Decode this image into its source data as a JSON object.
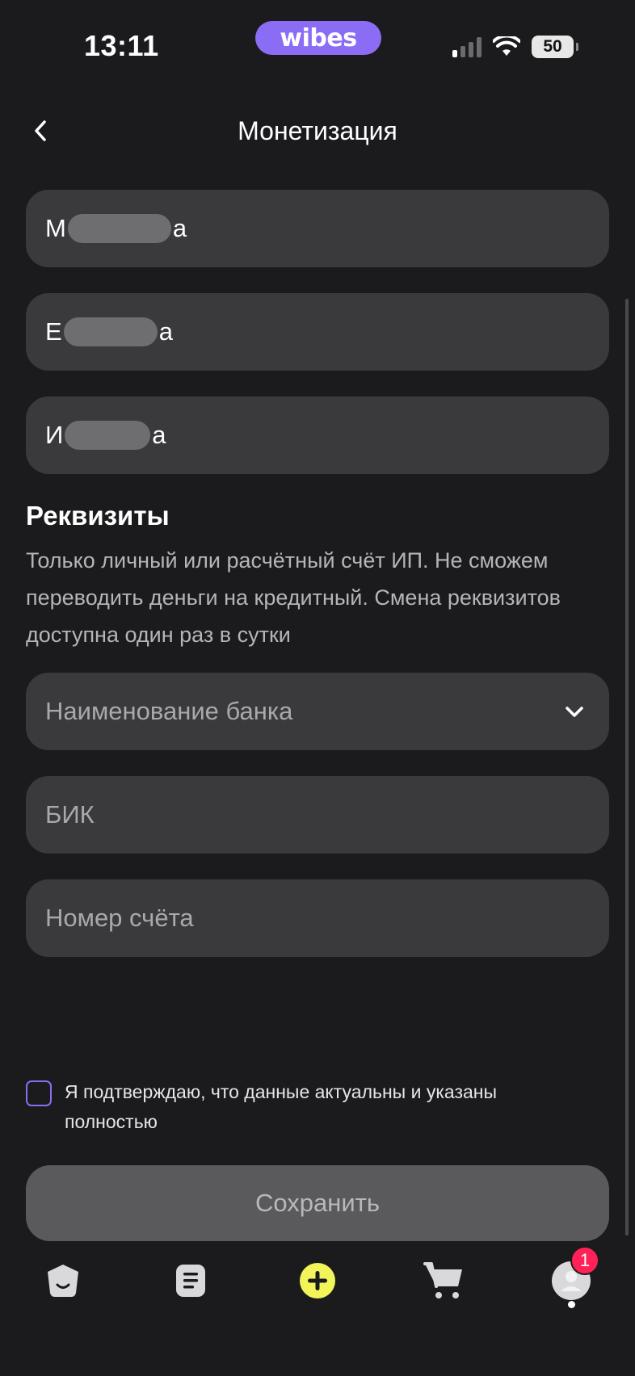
{
  "status_bar": {
    "time": "13:11",
    "app_pill": "wibes",
    "battery": "50"
  },
  "header": {
    "title": "Монетизация"
  },
  "name_fields": [
    {
      "prefix": "М",
      "suffix": "а"
    },
    {
      "prefix": "Е",
      "suffix": "а"
    },
    {
      "prefix": "И",
      "suffix": "а"
    }
  ],
  "requisites": {
    "title": "Реквизиты",
    "description": "Только личный или расчётный счёт ИП. Не сможем переводить деньги на кредитный. Смена реквизитов доступна один раз в сутки",
    "bank_placeholder": "Наименование банка",
    "bik_placeholder": "БИК",
    "account_placeholder": "Номер счёта"
  },
  "consent": {
    "text": "Я подтверждаю, что данные актуальны и указаны полностью",
    "checked": false
  },
  "save_button": "Сохранить",
  "nav": {
    "items": [
      "home-icon",
      "feed-icon",
      "create-icon",
      "cart-icon",
      "profile-icon"
    ],
    "profile_badge": "1"
  },
  "colors": {
    "accent": "#8b6cf5",
    "create_button": "#f2f55a",
    "badge": "#ff2158"
  }
}
